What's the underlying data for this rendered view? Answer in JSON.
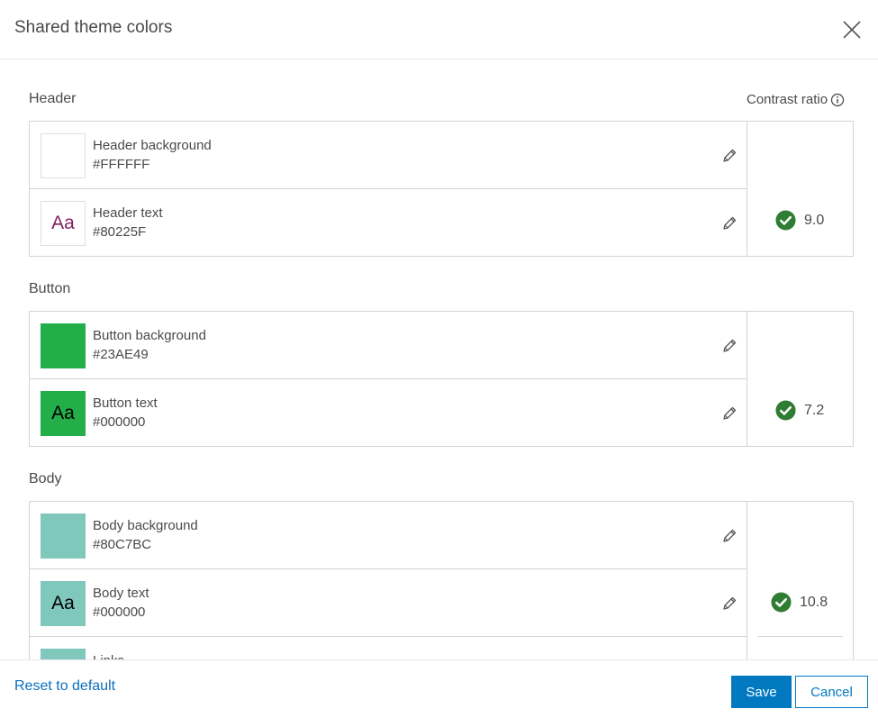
{
  "dialog": {
    "title": "Shared theme colors",
    "close_icon": "close-icon"
  },
  "contrast_header": "Contrast ratio",
  "sections": {
    "header": {
      "title": "Header",
      "ratio": "9.0",
      "rows": [
        {
          "name": "Header background",
          "hex": "#FFFFFF",
          "swatch_color": "#FFFFFF",
          "swatch_text": "",
          "text_color": ""
        },
        {
          "name": "Header text",
          "hex": "#80225F",
          "swatch_color": "#FFFFFF",
          "swatch_text": "Aa",
          "text_color": "#80225F"
        }
      ]
    },
    "button": {
      "title": "Button",
      "ratio": "7.2",
      "rows": [
        {
          "name": "Button background",
          "hex": "#23AE49",
          "swatch_color": "#23AE49",
          "swatch_text": "",
          "text_color": ""
        },
        {
          "name": "Button text",
          "hex": "#000000",
          "swatch_color": "#23AE49",
          "swatch_text": "Aa",
          "text_color": "#000000"
        }
      ]
    },
    "body": {
      "title": "Body",
      "ratio": "10.8",
      "rows": [
        {
          "name": "Body background",
          "hex": "#80C7BC",
          "swatch_color": "#80C7BC",
          "swatch_text": "",
          "text_color": ""
        },
        {
          "name": "Body text",
          "hex": "#000000",
          "swatch_color": "#80C7BC",
          "swatch_text": "Aa",
          "text_color": "#000000"
        },
        {
          "name": "Links",
          "hex": "",
          "swatch_color": "#80C7BC",
          "swatch_text": "",
          "text_color": ""
        }
      ]
    }
  },
  "footer": {
    "reset_label": "Reset to default",
    "save_label": "Save",
    "cancel_label": "Cancel"
  },
  "colors": {
    "accent": "#0079C1",
    "check_green": "#2E7D32",
    "link": "#0A6EBD"
  }
}
